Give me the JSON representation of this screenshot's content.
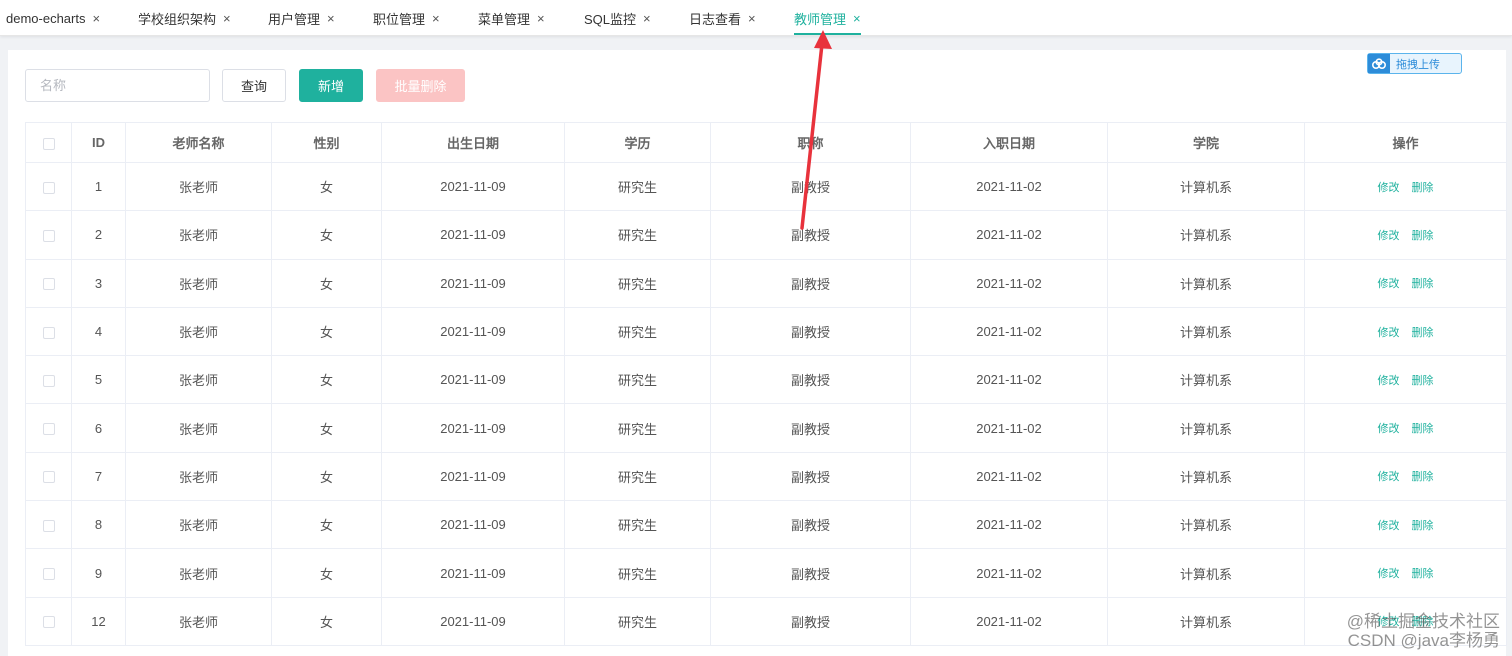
{
  "tabs": [
    {
      "label": "demo-echarts",
      "active": false
    },
    {
      "label": "学校组织架构",
      "active": false
    },
    {
      "label": "用户管理",
      "active": false
    },
    {
      "label": "职位管理",
      "active": false
    },
    {
      "label": "菜单管理",
      "active": false
    },
    {
      "label": "SQL监控",
      "active": false
    },
    {
      "label": "日志查看",
      "active": false
    },
    {
      "label": "教师管理",
      "active": true
    }
  ],
  "tab_close_glyph": "×",
  "toolbar": {
    "search_placeholder": "名称",
    "query_label": "查询",
    "add_label": "新增",
    "batch_delete_label": "批量删除",
    "upload_label": "拖拽上传"
  },
  "table": {
    "columns": [
      "",
      "ID",
      "老师名称",
      "性别",
      "出生日期",
      "学历",
      "职称",
      "入职日期",
      "学院",
      "操作"
    ],
    "actions": {
      "edit": "修改",
      "delete": "删除"
    },
    "rows": [
      {
        "id": "1",
        "name": "张老师",
        "gender": "女",
        "birth": "2021-11-09",
        "edu": "研究生",
        "title": "副教授",
        "hire": "2021-11-02",
        "college": "计算机系"
      },
      {
        "id": "2",
        "name": "张老师",
        "gender": "女",
        "birth": "2021-11-09",
        "edu": "研究生",
        "title": "副教授",
        "hire": "2021-11-02",
        "college": "计算机系"
      },
      {
        "id": "3",
        "name": "张老师",
        "gender": "女",
        "birth": "2021-11-09",
        "edu": "研究生",
        "title": "副教授",
        "hire": "2021-11-02",
        "college": "计算机系"
      },
      {
        "id": "4",
        "name": "张老师",
        "gender": "女",
        "birth": "2021-11-09",
        "edu": "研究生",
        "title": "副教授",
        "hire": "2021-11-02",
        "college": "计算机系"
      },
      {
        "id": "5",
        "name": "张老师",
        "gender": "女",
        "birth": "2021-11-09",
        "edu": "研究生",
        "title": "副教授",
        "hire": "2021-11-02",
        "college": "计算机系"
      },
      {
        "id": "6",
        "name": "张老师",
        "gender": "女",
        "birth": "2021-11-09",
        "edu": "研究生",
        "title": "副教授",
        "hire": "2021-11-02",
        "college": "计算机系"
      },
      {
        "id": "7",
        "name": "张老师",
        "gender": "女",
        "birth": "2021-11-09",
        "edu": "研究生",
        "title": "副教授",
        "hire": "2021-11-02",
        "college": "计算机系"
      },
      {
        "id": "8",
        "name": "张老师",
        "gender": "女",
        "birth": "2021-11-09",
        "edu": "研究生",
        "title": "副教授",
        "hire": "2021-11-02",
        "college": "计算机系"
      },
      {
        "id": "9",
        "name": "张老师",
        "gender": "女",
        "birth": "2021-11-09",
        "edu": "研究生",
        "title": "副教授",
        "hire": "2021-11-02",
        "college": "计算机系"
      },
      {
        "id": "12",
        "name": "张老师",
        "gender": "女",
        "birth": "2021-11-09",
        "edu": "研究生",
        "title": "副教授",
        "hire": "2021-11-02",
        "college": "计算机系"
      }
    ]
  },
  "watermark": {
    "line1": "@稀土掘金技术社区",
    "line2": "CSDN @java李杨勇"
  },
  "colors": {
    "accent": "#1fb19e",
    "danger_light": "#fbc4c4",
    "arrow": "#e8323c",
    "upload_blue": "#2d8cd9"
  },
  "icons": {
    "upload": "cloud-upload-icon",
    "tab_close": "close-icon",
    "annotation": "red-arrow-annotation"
  }
}
